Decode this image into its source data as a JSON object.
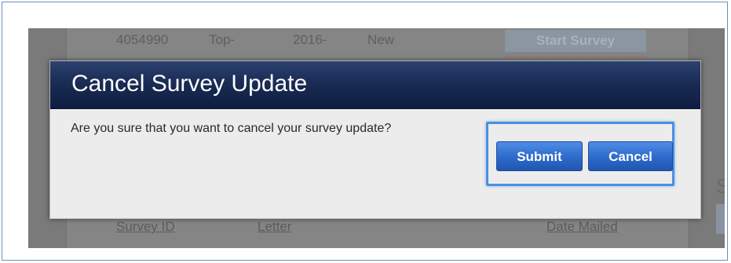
{
  "background": {
    "row": {
      "survey_id": "4054990",
      "letter": "Top-",
      "date": "2016-",
      "status": "New",
      "start_button": "Start Survey"
    },
    "headers": {
      "survey_id": "Survey ID",
      "letter": "Letter",
      "date_mailed": "Date Mailed"
    },
    "right_glyph": "S"
  },
  "dialog": {
    "title": "Cancel Survey Update",
    "message": "Are you sure that you want to cancel your survey update?",
    "submit_label": "Submit",
    "cancel_label": "Cancel"
  },
  "colors": {
    "header_dark": "#1a2c55",
    "button_blue": "#2f6ccc",
    "focus_ring": "#4a90e2"
  }
}
